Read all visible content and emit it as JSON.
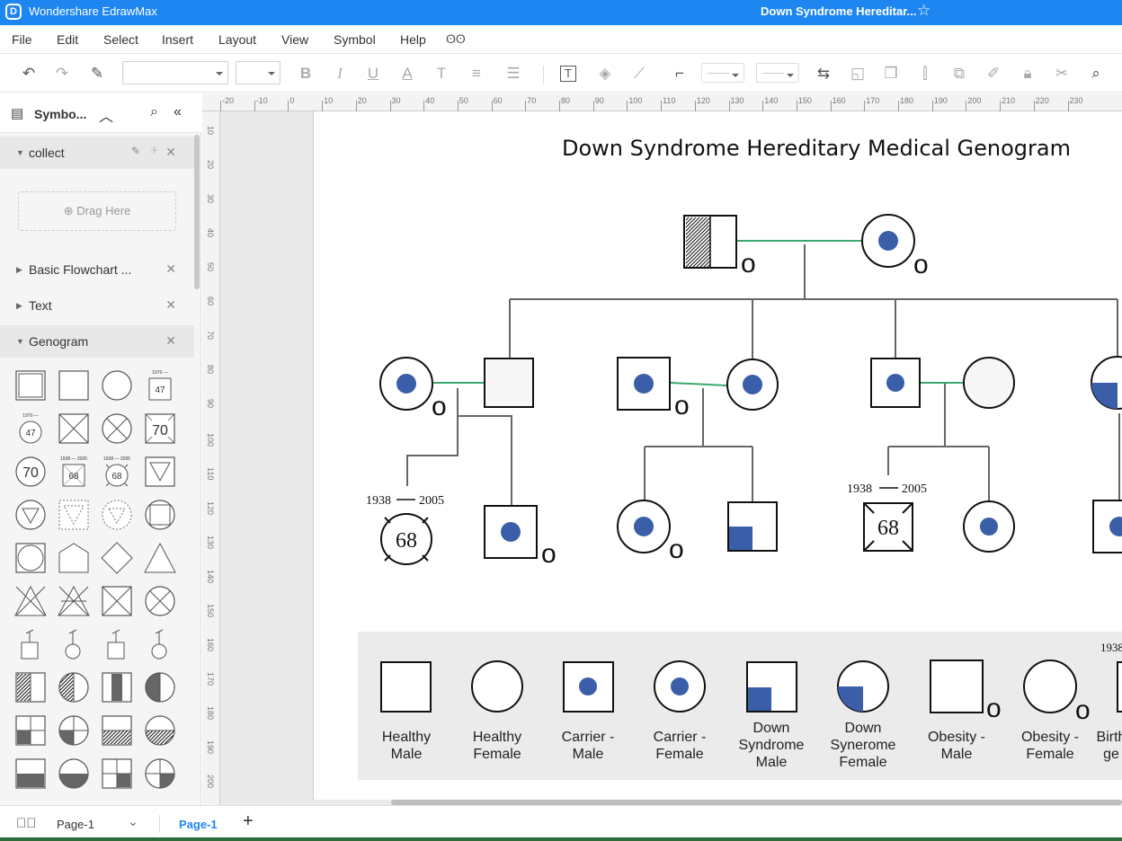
{
  "app": {
    "name": "Wondershare EdrawMax",
    "doc_title": "Down Syndrome Hereditar..."
  },
  "menu": [
    "File",
    "Edit",
    "Select",
    "Insert",
    "Layout",
    "View",
    "Symbol",
    "Help"
  ],
  "sidebar": {
    "title": "Symbo...",
    "sections": [
      {
        "label": "collect"
      },
      {
        "label": "Basic Flowchart ..."
      },
      {
        "label": "Text"
      },
      {
        "label": "Genogram"
      }
    ],
    "drag_here": "Drag Here",
    "genogram_symbols": [
      {
        "kind": "double-square"
      },
      {
        "kind": "square"
      },
      {
        "kind": "circle"
      },
      {
        "kind": "age-square",
        "label": "47",
        "year": "1970 —"
      },
      {
        "kind": "age-circle",
        "label": "47",
        "year": "1970 —"
      },
      {
        "kind": "x-square"
      },
      {
        "kind": "x-circle"
      },
      {
        "kind": "age-square",
        "label": "70"
      },
      {
        "kind": "age-circle",
        "label": "70"
      },
      {
        "kind": "dead-square",
        "label": "68",
        "year": "1938 — 2005"
      },
      {
        "kind": "dead-circle",
        "label": "68",
        "year": "1938 — 2005"
      },
      {
        "kind": "triangle-down-square"
      },
      {
        "kind": "triangle-down-circle"
      },
      {
        "kind": "dashed-triangle-square"
      },
      {
        "kind": "dashed-triangle-circle"
      },
      {
        "kind": "square-in-circle"
      },
      {
        "kind": "circle-in-square"
      },
      {
        "kind": "pentagon"
      },
      {
        "kind": "diamond"
      },
      {
        "kind": "triangle"
      },
      {
        "kind": "x-triangle"
      },
      {
        "kind": "x-triangle-dash"
      },
      {
        "kind": "x-square-small"
      },
      {
        "kind": "x-circle-small"
      },
      {
        "kind": "arrow-square"
      },
      {
        "kind": "arrow-circle"
      },
      {
        "kind": "arrow-square"
      },
      {
        "kind": "arrow-circle"
      },
      {
        "kind": "half-square-left"
      },
      {
        "kind": "half-circle-left-hatch"
      },
      {
        "kind": "half-square-center"
      },
      {
        "kind": "half-circle-left-dark"
      },
      {
        "kind": "quarter-square"
      },
      {
        "kind": "quarter-circle"
      },
      {
        "kind": "half-square-bottom-hatch"
      },
      {
        "kind": "half-circle-bottom-hatch"
      },
      {
        "kind": "half-square-bottom"
      },
      {
        "kind": "half-circle-bottom"
      },
      {
        "kind": "quarter-square-br"
      },
      {
        "kind": "quarter-circle-br"
      },
      {
        "kind": "partial-square"
      },
      {
        "kind": "partial-circle"
      },
      {
        "kind": "partial-square"
      },
      {
        "kind": "partial-circle"
      }
    ]
  },
  "ruler": {
    "h_labels": [
      "-20",
      "-10",
      "0",
      "10",
      "20",
      "30",
      "40",
      "50",
      "60",
      "70",
      "80",
      "90",
      "100",
      "110",
      "120",
      "130",
      "140",
      "150",
      "160",
      "170",
      "180",
      "190",
      "200",
      "210",
      "220",
      "230"
    ],
    "v_labels": [
      "10",
      "20",
      "30",
      "40",
      "50",
      "60",
      "70",
      "80",
      "90",
      "100",
      "110",
      "120",
      "130",
      "140",
      "150",
      "160",
      "170",
      "180",
      "190",
      "200",
      "10"
    ]
  },
  "diagram": {
    "title": "Down Syndrome Hereditary Medical Genogram",
    "person_marker": "o",
    "dates": {
      "from": "1938",
      "to": "2005",
      "age": "68",
      "partial": "1938"
    },
    "legend": [
      {
        "lines": [
          "Healthy",
          "Male"
        ]
      },
      {
        "lines": [
          "Healthy",
          "Female"
        ]
      },
      {
        "lines": [
          "Carrier -",
          "Male"
        ]
      },
      {
        "lines": [
          "Carrier -",
          "Female"
        ]
      },
      {
        "lines": [
          "Down",
          "Syndrome",
          "Male"
        ]
      },
      {
        "lines": [
          "Down",
          "Synerome",
          "Female"
        ]
      },
      {
        "lines": [
          "Obesity -",
          "Male"
        ]
      },
      {
        "lines": [
          "Obesity -",
          "Female"
        ]
      },
      {
        "lines": [
          "Birth",
          "ge"
        ]
      }
    ]
  },
  "pages": {
    "selector": "Page-1",
    "active_tab": "Page-1"
  },
  "colors": {
    "accent": "#1e86f0",
    "carrier": "#3a5fa8",
    "marriage": "#3aa86e"
  }
}
